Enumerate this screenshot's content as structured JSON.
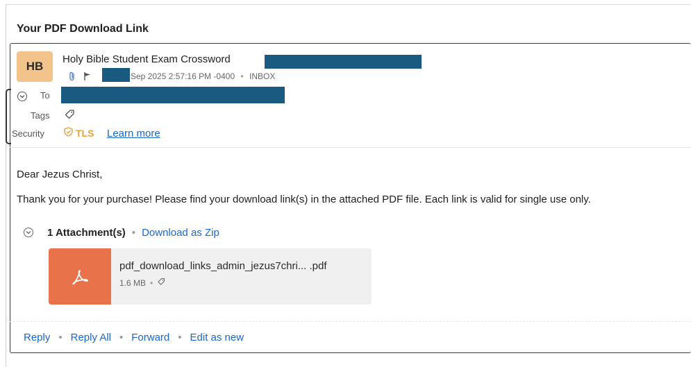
{
  "email": {
    "subject": "Your PDF Download Link",
    "avatar_initials": "HB",
    "sender_name": "Holy Bible Student Exam Crossword",
    "date_text": "Sep 2025 2:57:16 PM -0400",
    "folder": "INBOX",
    "meta_separator": "•",
    "to_label": "To",
    "tags_label": "Tags",
    "security_label": "Security",
    "security_value": "TLS",
    "learn_more": "Learn more",
    "greeting": "Dear Jezus Christ,",
    "body": "Thank you for your purchase! Please find your download link(s) in the attached PDF file. Each link is valid for single use only."
  },
  "attachments": {
    "count_label": "1 Attachment(s)",
    "separator": "•",
    "download_zip": "Download as Zip",
    "file": {
      "name": "pdf_download_links_admin_jezus7chri... .pdf",
      "size": "1.6 MB",
      "size_separator": "•",
      "type_icon": "pdf-icon"
    }
  },
  "actions": {
    "reply": "Reply",
    "reply_all": "Reply All",
    "forward": "Forward",
    "edit_as_new": "Edit as new",
    "separator": "•"
  },
  "colors": {
    "avatar_bg": "#f2c38a",
    "link": "#1a67c9",
    "tls": "#e6a23c",
    "pdf_thumb": "#e8734b",
    "redaction": "#1b5a80"
  }
}
